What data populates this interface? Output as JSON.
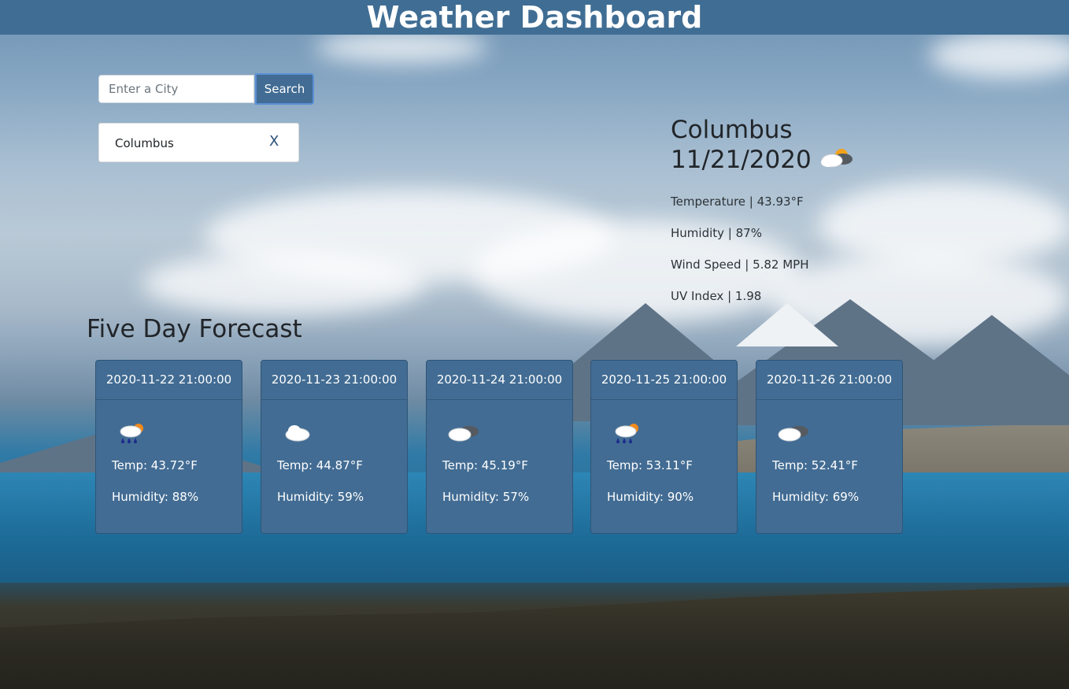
{
  "header": {
    "title": "Weather Dashboard"
  },
  "search": {
    "placeholder": "Enter a City",
    "value": "",
    "button_label": "Search"
  },
  "history": [
    {
      "city": "Columbus",
      "remove_label": "X"
    }
  ],
  "current": {
    "city": "Columbus",
    "date": "11/21/2020",
    "icon": "cloud-sun-icon",
    "temperature": "Temperature | 43.93°F",
    "humidity": "Humidity | 87%",
    "wind": "Wind Speed | 5.82 MPH",
    "uv": "UV Index | 1.98"
  },
  "forecast": {
    "title": "Five Day Forecast",
    "days": [
      {
        "datetime": "2020-11-22 21:00:00",
        "icon": "rain-sun-icon",
        "temp": "Temp: 43.72°F",
        "humidity": "Humidity: 88%"
      },
      {
        "datetime": "2020-11-23 21:00:00",
        "icon": "cloud-icon",
        "temp": "Temp: 44.87°F",
        "humidity": "Humidity: 59%"
      },
      {
        "datetime": "2020-11-24 21:00:00",
        "icon": "broken-clouds-icon",
        "temp": "Temp: 45.19°F",
        "humidity": "Humidity: 57%"
      },
      {
        "datetime": "2020-11-25 21:00:00",
        "icon": "rain-sun-icon",
        "temp": "Temp: 53.11°F",
        "humidity": "Humidity: 90%"
      },
      {
        "datetime": "2020-11-26 21:00:00",
        "icon": "broken-clouds-icon",
        "temp": "Temp: 52.41°F",
        "humidity": "Humidity: 69%"
      }
    ]
  },
  "colors": {
    "header_bg": "#406d93",
    "card_bg": "#426c93",
    "button_bg": "#426c93",
    "text_dark": "#212529"
  }
}
